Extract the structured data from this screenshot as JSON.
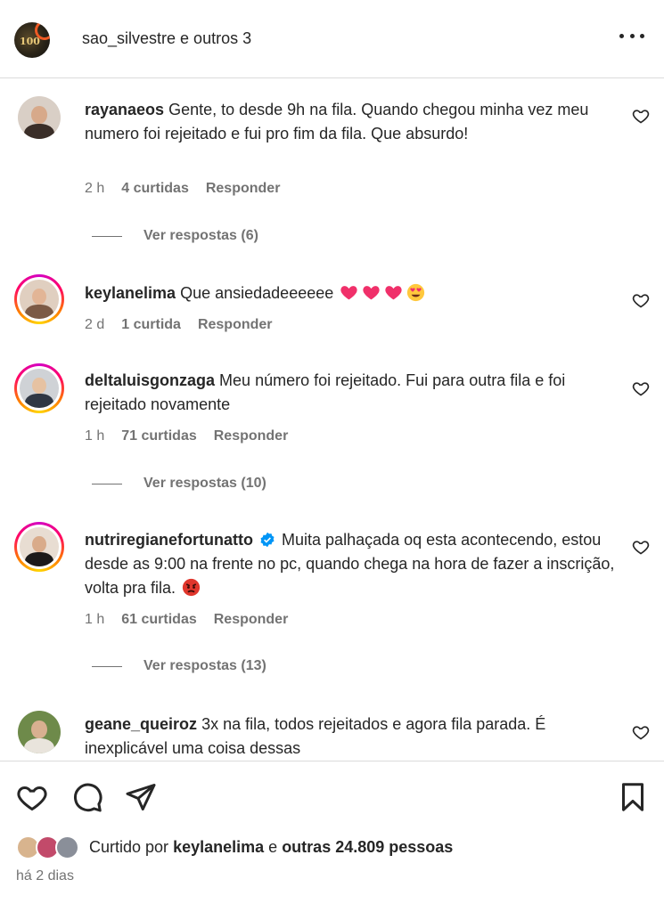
{
  "header": {
    "title": "sao_silvestre e outros 3",
    "avatar_text": "100",
    "more_icon": "more-horizontal-icon"
  },
  "comments": [
    {
      "username": "rayanaeos",
      "text": "Gente, to desde 9h na fila. Quando chegou minha vez meu numero foi rejeitado e fui pro fim da fila. Que absurdo!",
      "time": "2 h",
      "likes": "4 curtidas",
      "reply": "Responder",
      "view_replies": "Ver respostas (6)"
    },
    {
      "username": "keylanelima",
      "text": "Que ansiedadeeeeee",
      "emojis": [
        "heart-emoji",
        "heart-emoji",
        "heart-emoji",
        "heart-eyes-emoji"
      ],
      "time": "2 d",
      "likes": "1 curtida",
      "reply": "Responder"
    },
    {
      "username": "deltaluisgonzaga",
      "text": "Meu número foi rejeitado. Fui para outra fila e foi rejeitado novamente",
      "time": "1 h",
      "likes": "71 curtidas",
      "reply": "Responder",
      "view_replies": "Ver respostas (10)"
    },
    {
      "username": "nutriregianefortunatto",
      "verified": true,
      "text": "Muita palhaçada oq esta acontecendo, estou desde as 9:00 na frente no pc, quando chega na hora de fazer a inscrição, volta pra fila.",
      "emojis": [
        "angry-face-emoji"
      ],
      "time": "1 h",
      "likes": "61 curtidas",
      "reply": "Responder",
      "view_replies": "Ver respostas (13)"
    },
    {
      "username": "geane_queiroz",
      "text": "3x na fila, todos rejeitados e agora fila parada. É inexplicável uma coisa dessas"
    }
  ],
  "actions": {
    "like_icon": "heart-outline-icon",
    "comment_icon": "comment-bubble-icon",
    "share_icon": "paper-plane-icon",
    "save_icon": "bookmark-icon"
  },
  "likes_summary": {
    "prefix": "Curtido por",
    "user": "keylanelima",
    "connector": "e",
    "others": "outras 24.809 pessoas"
  },
  "post_date": "há 2 dias",
  "colors": {
    "text": "#262626",
    "secondary": "#737373",
    "divider": "#dbdbdb",
    "verified": "#0095f6",
    "heart_emoji": "#f0306a"
  }
}
